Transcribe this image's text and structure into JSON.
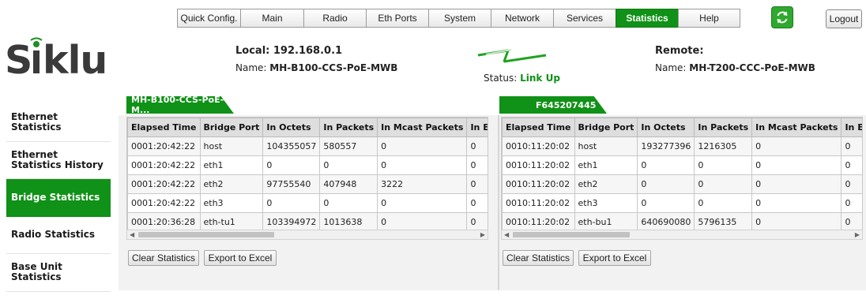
{
  "nav": {
    "items": [
      "Quick Config.",
      "Main",
      "Radio",
      "Eth Ports",
      "System",
      "Network",
      "Services",
      "Statistics",
      "Help"
    ],
    "active": "Statistics",
    "logout_label": "Logout",
    "refresh_icon": "refresh-icon"
  },
  "brand": {
    "logo_text": "Siklu",
    "accent_color": "#109117"
  },
  "local": {
    "label": "Local: 192.168.0.1",
    "name_prefix": "Name: ",
    "name": "MH-B100-CCS-PoE-MWB"
  },
  "remote": {
    "label": "Remote:",
    "name_prefix": "Name: ",
    "name": "MH-T200-CCC-PoE-MWB"
  },
  "status": {
    "prefix": "Status: ",
    "value": "Link Up"
  },
  "sidebar": {
    "items": [
      "Ethernet Statistics",
      "Ethernet Statistics History",
      "Bridge Statistics",
      "Radio Statistics",
      "Base Unit Statistics"
    ],
    "active": "Bridge Statistics"
  },
  "left_panel": {
    "tab": "MH-B100-CCS-PoE-M...",
    "columns": [
      "Elapsed Time",
      "Bridge Port",
      "In Octets",
      "In Packets",
      "In Mcast Packets",
      "In Errors"
    ],
    "rows": [
      [
        "0001:20:42:22",
        "host",
        "104355057",
        "580557",
        "0",
        "0"
      ],
      [
        "0001:20:42:22",
        "eth1",
        "0",
        "0",
        "0",
        "0"
      ],
      [
        "0001:20:42:22",
        "eth2",
        "97755540",
        "407948",
        "3222",
        "0"
      ],
      [
        "0001:20:42:22",
        "eth3",
        "0",
        "0",
        "0",
        "0"
      ],
      [
        "0001:20:36:28",
        "eth-tu1",
        "103394972",
        "1013638",
        "0",
        "0"
      ]
    ],
    "clear_label": "Clear Statistics",
    "export_label": "Export to Excel"
  },
  "right_panel": {
    "tab": "F645207445",
    "columns": [
      "Elapsed Time",
      "Bridge Port",
      "In Octets",
      "In Packets",
      "In Mcast Packets",
      "In Errors"
    ],
    "rows": [
      [
        "0010:11:20:02",
        "host",
        "193277396",
        "1216305",
        "0",
        "0"
      ],
      [
        "0010:11:20:02",
        "eth1",
        "0",
        "0",
        "0",
        "0"
      ],
      [
        "0010:11:20:02",
        "eth2",
        "0",
        "0",
        "0",
        "0"
      ],
      [
        "0010:11:20:02",
        "eth3",
        "0",
        "0",
        "0",
        "0"
      ],
      [
        "0010:11:20:02",
        "eth-bu1",
        "640690080",
        "5796135",
        "0",
        "0"
      ]
    ],
    "clear_label": "Clear Statistics",
    "export_label": "Export to Excel"
  }
}
